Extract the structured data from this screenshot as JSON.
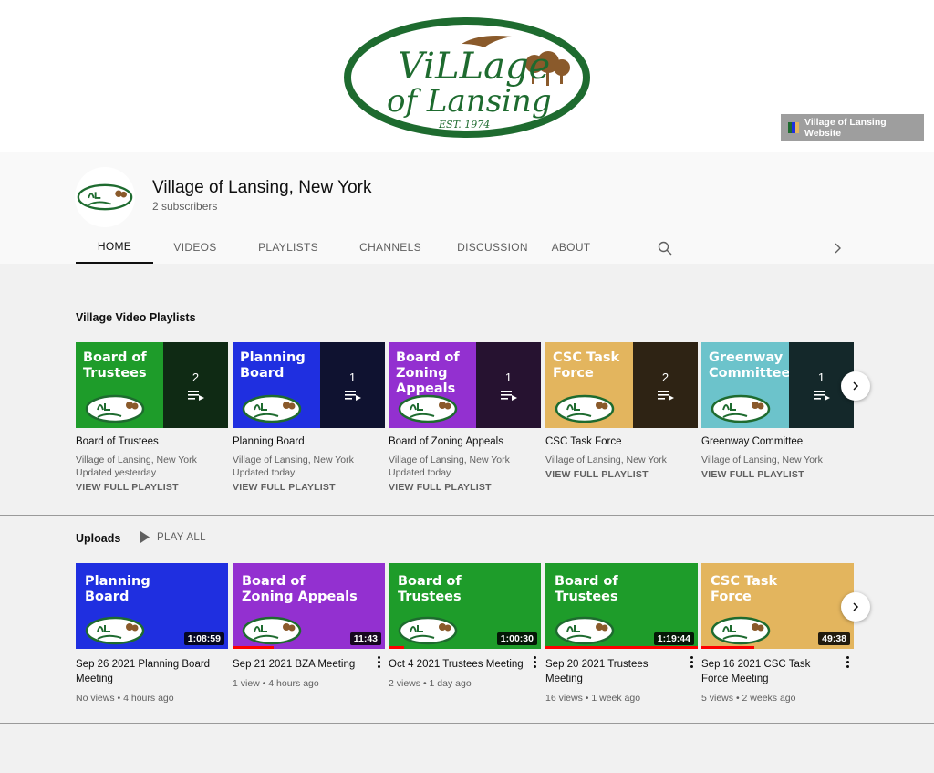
{
  "banner": {
    "logo_text": {
      "line1": "ViLLage",
      "line2": "of Lansing",
      "est": "EST. 1974"
    },
    "website_link_label": "Village of Lansing Website"
  },
  "channel": {
    "name": "Village of Lansing, New York",
    "subscribers": "2 subscribers"
  },
  "tabs": [
    {
      "label": "HOME",
      "active": true
    },
    {
      "label": "VIDEOS"
    },
    {
      "label": "PLAYLISTS"
    },
    {
      "label": "CHANNELS"
    },
    {
      "label": "DISCUSSION"
    },
    {
      "label": "ABOUT"
    }
  ],
  "playlists": {
    "title": "Village Video Playlists",
    "items": [
      {
        "thumb_label": "Board of Trustees",
        "count": "2",
        "title": "Board of Trustees",
        "channel": "Village of Lansing, New York",
        "updated": "Updated yesterday",
        "link": "VIEW FULL PLAYLIST",
        "main_color": "#1e9c2a",
        "side_color": "#0f2a14"
      },
      {
        "thumb_label": "Planning Board",
        "count": "1",
        "title": "Planning Board",
        "channel": "Village of Lansing, New York",
        "updated": "Updated today",
        "link": "VIEW FULL PLAYLIST",
        "main_color": "#1f2fe0",
        "side_color": "#0f1230"
      },
      {
        "thumb_label": "Board of Zoning Appeals",
        "count": "1",
        "title": "Board of Zoning Appeals",
        "channel": "Village of Lansing, New York",
        "updated": "Updated today",
        "link": "VIEW FULL PLAYLIST",
        "main_color": "#9330d0",
        "side_color": "#261230"
      },
      {
        "thumb_label": "CSC Task Force",
        "count": "2",
        "title": "CSC Task Force",
        "channel": "Village of Lansing, New York",
        "updated": "",
        "link": "VIEW FULL PLAYLIST",
        "main_color": "#e3b55e",
        "side_color": "#2e2314"
      },
      {
        "thumb_label": "Greenway Committee",
        "count": "1",
        "title": "Greenway Committee",
        "channel": "Village of Lansing, New York",
        "updated": "",
        "link": "VIEW FULL PLAYLIST",
        "main_color": "#6cc3cb",
        "side_color": "#14282a"
      }
    ]
  },
  "uploads": {
    "title": "Uploads",
    "play_all_label": "PLAY ALL",
    "items": [
      {
        "thumb_label": "Planning Board",
        "duration": "1:08:59",
        "title": "Sep 26 2021 Planning Board Meeting",
        "views": "No views",
        "age": "4 hours ago",
        "color": "#1f2fe0",
        "progress": 0
      },
      {
        "thumb_label": "Board of Zoning Appeals",
        "duration": "11:43",
        "title": "Sep 21 2021 BZA Meeting",
        "views": "1 view",
        "age": "4 hours ago",
        "color": "#9330d0",
        "progress": 0.27
      },
      {
        "thumb_label": "Board of Trustees",
        "duration": "1:00:30",
        "title": "Oct 4 2021 Trustees Meeting",
        "views": "2 views",
        "age": "1 day ago",
        "color": "#1e9c2a",
        "progress": 0.1
      },
      {
        "thumb_label": "Board of Trustees",
        "duration": "1:19:44",
        "title": "Sep 20 2021 Trustees Meeting",
        "views": "16 views",
        "age": "1 week ago",
        "color": "#1e9c2a",
        "progress": 1.0
      },
      {
        "thumb_label": "CSC Task Force",
        "duration": "49:38",
        "title": "Sep 16 2021 CSC Task Force Meeting",
        "views": "5 views",
        "age": "2 weeks ago",
        "color": "#e3b55e",
        "progress": 0.35
      }
    ]
  },
  "colors": {
    "logo_green": "#1e6b2f",
    "logo_brown": "#8a5a2b",
    "progress_red": "#ff0000"
  }
}
